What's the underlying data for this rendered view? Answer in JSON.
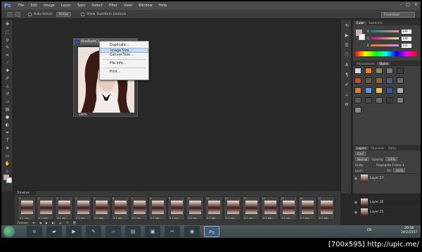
{
  "menubar": {
    "logo": "Ps",
    "items": [
      "File",
      "Edit",
      "Image",
      "Layer",
      "Type",
      "Select",
      "Filter",
      "View",
      "Window",
      "Help"
    ],
    "window_controls": [
      "–",
      "□",
      "✕"
    ]
  },
  "optionsbar": {
    "auto_select_label": "Auto-Select:",
    "auto_select_value": "Group",
    "show_transform_label": "Show Transform Controls",
    "workspace": "Essentials"
  },
  "document": {
    "title": "i8naDw9C.j...",
    "zoom": "100%"
  },
  "context_menu": {
    "items": [
      "Duplicate...",
      "Image Size...",
      "Canvas Size...",
      "File Info...",
      "Print..."
    ],
    "highlighted_index": 1
  },
  "color_panel": {
    "tabs": [
      "Color",
      "Swatches"
    ],
    "sliders": [
      {
        "letter": "R",
        "value": "209"
      },
      {
        "letter": "G",
        "value": "138"
      },
      {
        "letter": "B",
        "value": "141"
      }
    ]
  },
  "styles_panel": {
    "tabs": [
      "Adjustments",
      "Styles"
    ],
    "swatch_colors": [
      "#d9d9d9",
      "#f07b2a",
      "#8a8a5c",
      "#7a7a7a",
      "#3b3b3b",
      "#c84a2a",
      "#6a5a3a",
      "#8a6a3a",
      "#5a5a7a",
      "#6a6a6a",
      "#e07b3a",
      "#5a9ad0",
      "#e8c04a",
      "#3a5a9a",
      "#b0b0b0",
      "#5a5a5a",
      "#4a4a4a",
      "#6a6a6a",
      "#3a3a3a",
      "#7a7a7a",
      "#8a8a8a"
    ]
  },
  "layers_panel": {
    "tabs": [
      "Layers",
      "Channels",
      "Paths"
    ],
    "kind_label": "Kind",
    "blend_mode": "Normal",
    "opacity_label": "Opacity:",
    "opacity_value": "100%",
    "unify_label": "Unify:",
    "propagate_label": "Propagate Frame 1",
    "lock_label": "Lock:",
    "fill_label": "Fill:",
    "fill_value": "100%",
    "layers": [
      "Layer 27",
      "Layer 26",
      "Layer 25"
    ]
  },
  "timeline": {
    "title": "Timeline",
    "frame_count": 17,
    "frame_delay": "0.1 sec.",
    "loop_option": "Forever"
  },
  "taskbar": {
    "language": "EN",
    "time": "20:58",
    "date": "24/2/2557"
  },
  "footer": {
    "text": "[700x595] http://upic.me/"
  }
}
